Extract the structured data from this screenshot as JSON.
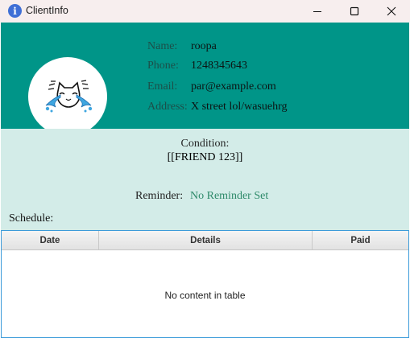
{
  "window": {
    "title": "ClientInfo",
    "icon": "info-icon"
  },
  "client": {
    "name_label": "Name:",
    "name": "roopa",
    "phone_label": "Phone:",
    "phone": "1248345643",
    "email_label": "Email:",
    "email": "par@example.com",
    "address_label": "Address:",
    "address": "X street lol/wasuehrg",
    "avatar": "crying-cat-avatar"
  },
  "condition": {
    "label": "Condition:",
    "value": "[[FRIEND 123]]"
  },
  "reminder": {
    "label": "Reminder:",
    "value": "No Reminder Set"
  },
  "schedule": {
    "label": "Schedule:",
    "columns": [
      "Date",
      "Details",
      "Paid"
    ],
    "empty_message": "No content in table"
  },
  "colors": {
    "header_bg": "#009588",
    "panel_bg": "#d3ece8",
    "reminder_text": "#2e8a6a",
    "table_focus_border": "#3a9ad9"
  }
}
